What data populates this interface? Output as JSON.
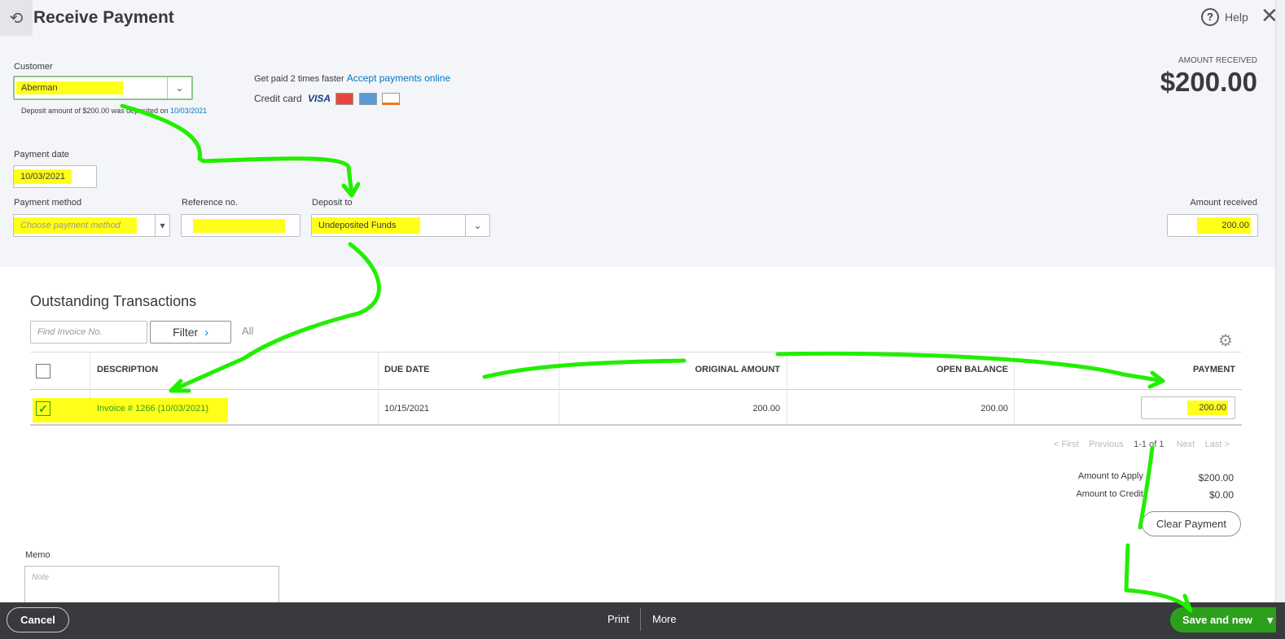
{
  "header": {
    "title": "Receive Payment",
    "help": "Help"
  },
  "customer": {
    "label": "Customer",
    "value": "Aberman",
    "deposit_note": "Deposit amount of $200.00 was deposited on",
    "deposit_date": "10/03/2021"
  },
  "promo": {
    "text": "Get paid 2 times faster",
    "link": "Accept payments online",
    "credit_card": "Credit card",
    "visa": "VISA"
  },
  "amount_received_header": {
    "label": "AMOUNT RECEIVED",
    "value": "$200.00"
  },
  "payment_date": {
    "label": "Payment date",
    "value": "10/03/2021"
  },
  "payment_method": {
    "label": "Payment method",
    "placeholder": "Choose payment method"
  },
  "reference": {
    "label": "Reference no.",
    "value": ""
  },
  "deposit_to": {
    "label": "Deposit to",
    "value": "Undeposited Funds"
  },
  "amount_received": {
    "label": "Amount received",
    "value": "200.00"
  },
  "outstanding": {
    "title": "Outstanding Transactions",
    "find_placeholder": "Find Invoice No.",
    "filter": "Filter",
    "all": "All",
    "columns": [
      "DESCRIPTION",
      "DUE DATE",
      "ORIGINAL AMOUNT",
      "OPEN BALANCE",
      "PAYMENT"
    ],
    "rows": [
      {
        "checked": true,
        "description": "Invoice # 1266 (10/03/2021)",
        "due_date": "10/15/2021",
        "original": "200.00",
        "open": "200.00",
        "payment": "200.00"
      }
    ]
  },
  "pagination": {
    "first": "< First",
    "previous": "Previous",
    "range": "1-1 of 1",
    "next": "Next",
    "last": "Last >"
  },
  "totals": {
    "apply_label": "Amount to Apply",
    "apply_value": "$200.00",
    "credit_label": "Amount to Credit",
    "credit_value": "$0.00",
    "clear": "Clear Payment"
  },
  "memo": {
    "label": "Memo",
    "placeholder": "Note"
  },
  "footer": {
    "cancel": "Cancel",
    "print": "Print",
    "more": "More",
    "save": "Save and new"
  },
  "colors": {
    "green": "#2ca01c",
    "link": "#0077c5",
    "footer": "#393a3d"
  }
}
